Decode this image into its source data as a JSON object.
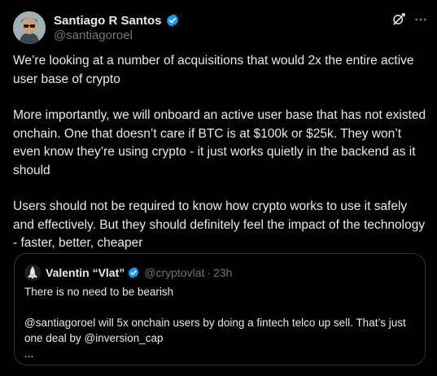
{
  "post": {
    "author": {
      "name": "Santiago R Santos",
      "handle": "@santiagoroel"
    },
    "paragraphs": [
      "We’re looking at a number of acquisitions that would 2x the entire active user base of crypto",
      "More importantly, we will onboard an active user base that has not existed onchain. One that doesn’t care if BTC is at $100k or $25k. They won’t even know they’re using crypto - it just works quietly in the backend as it should",
      "Users should not be required to know how crypto works to use it safely and effectively. But they should definitely feel the impact of the technology - faster, better, cheaper"
    ],
    "icons": {
      "grok": "grok-icon",
      "more": "more-options-icon",
      "verified": "verified-badge-icon"
    }
  },
  "quote": {
    "author": {
      "name": "Valentin “Vlat”",
      "handle": "@cryptovlat",
      "separator": "·",
      "time": "23h"
    },
    "lines": [
      "There is no need to be bearish",
      "@santiagoroel will 5x onchain users by doing a fintech telco up sell. That’s just one deal by @inversion_cap",
      "..."
    ]
  },
  "colors": {
    "background": "#000000",
    "text": "#e7e9ea",
    "secondary_text": "#71767b",
    "border": "#2f3336",
    "verified_blue": "#1d9bf0"
  }
}
